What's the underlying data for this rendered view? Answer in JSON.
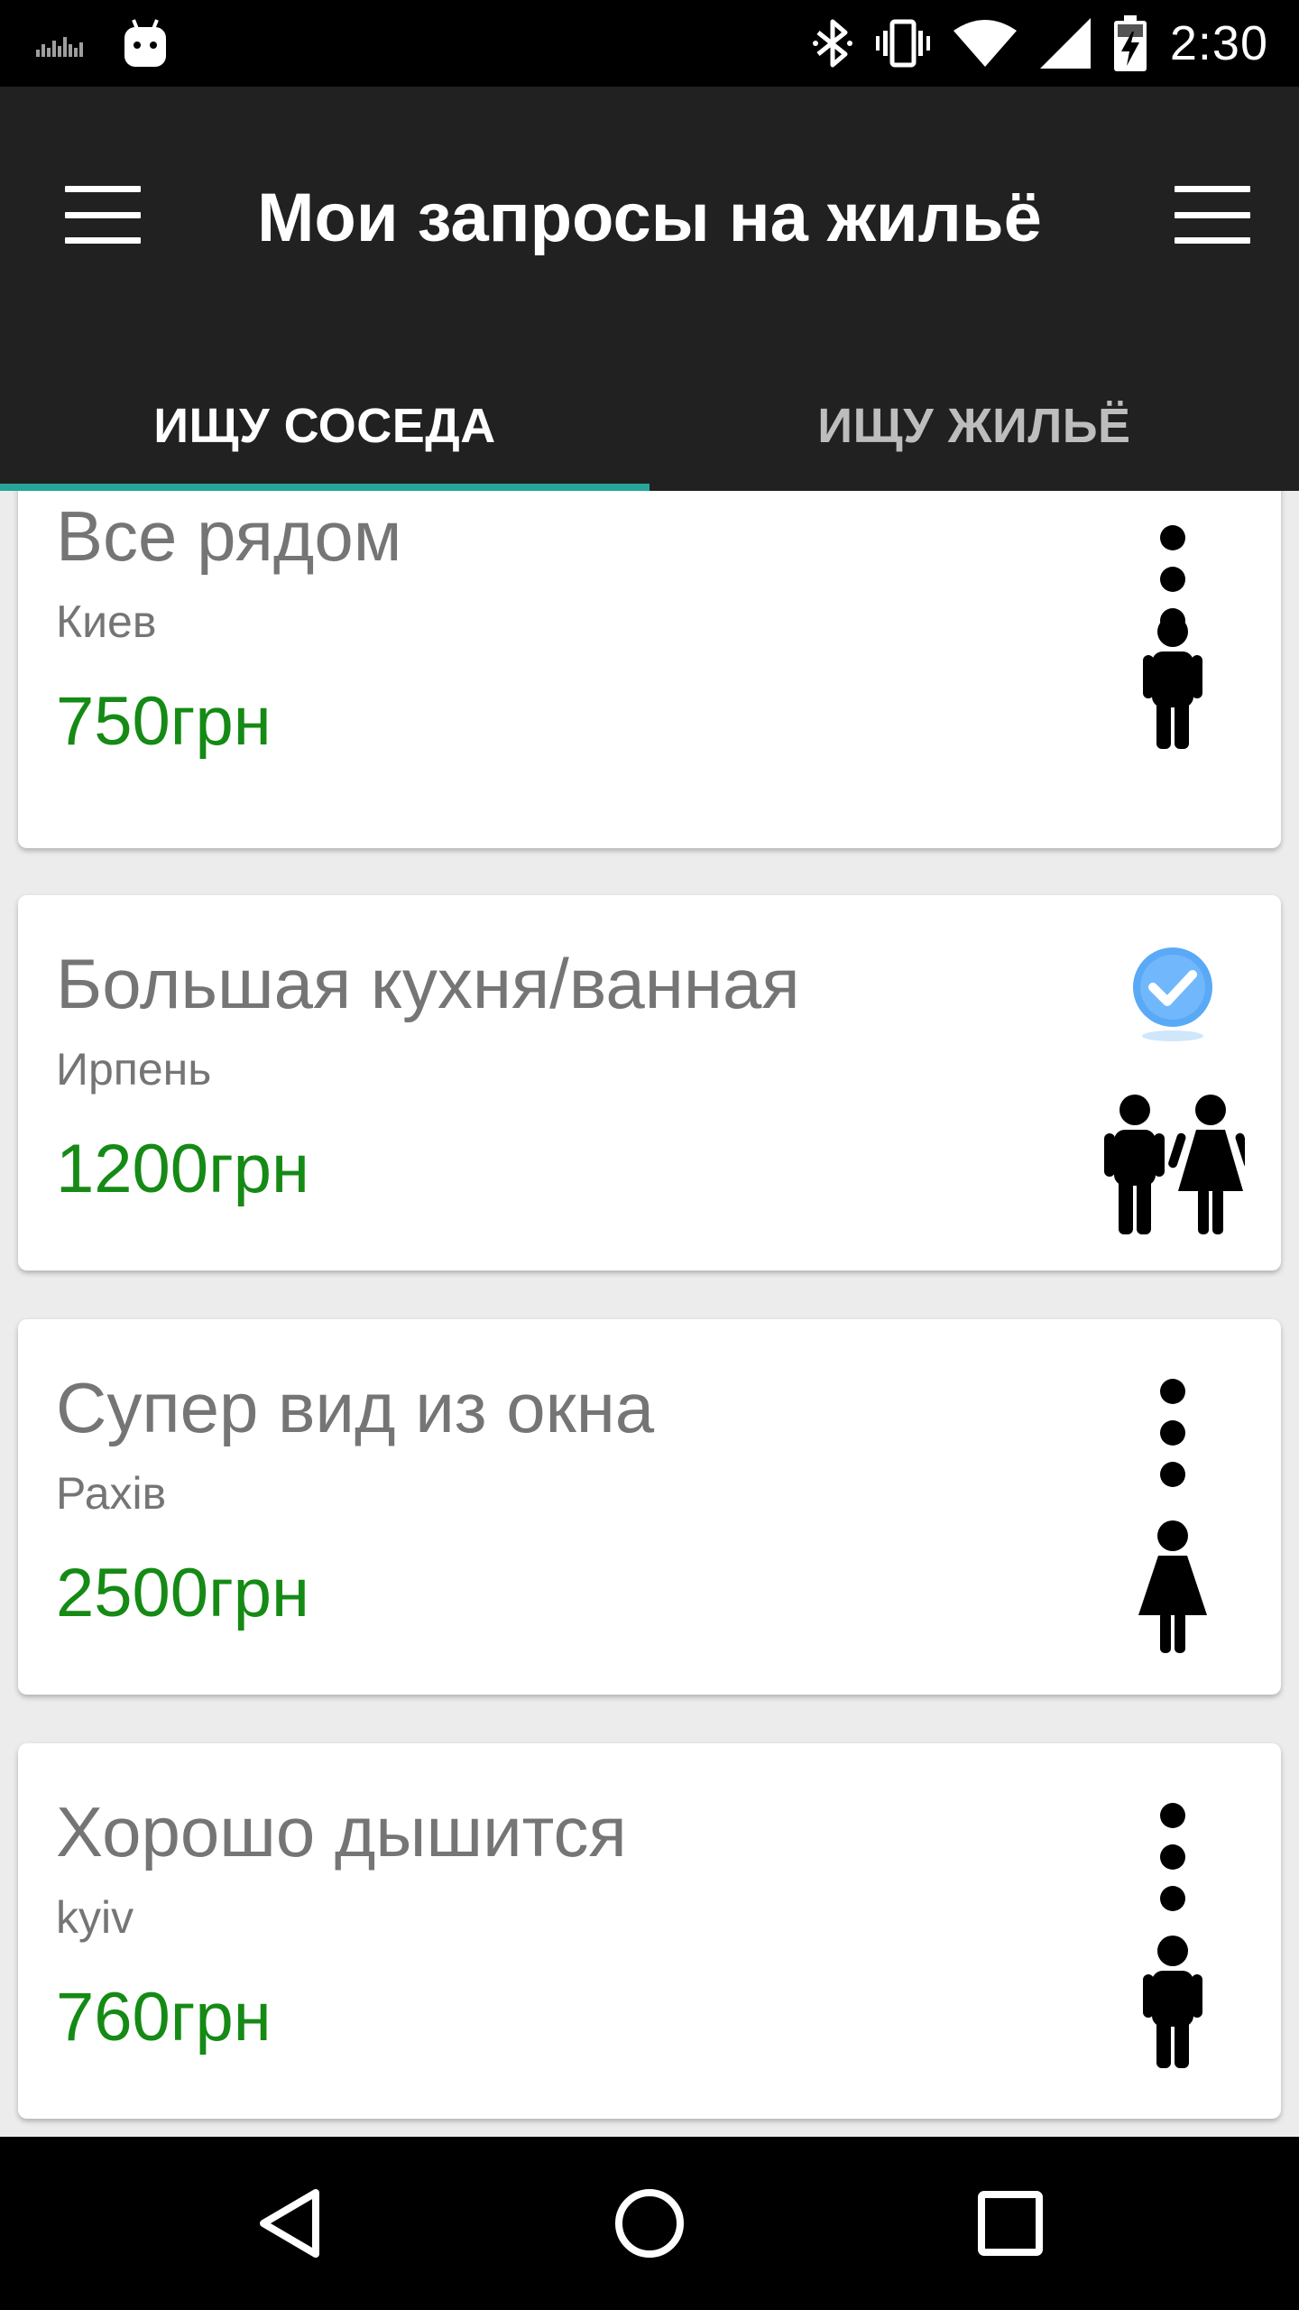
{
  "status_bar": {
    "time": "2:30",
    "icons": [
      "signal-strength-icon",
      "android-notification-icon",
      "bluetooth-icon",
      "vibrate-icon",
      "wifi-icon",
      "cell-signal-icon",
      "battery-charging-icon"
    ]
  },
  "app_bar": {
    "title": "Мои запросы на жильё",
    "left_icon": "menu-icon",
    "right_icon": "menu-icon"
  },
  "tabs": [
    {
      "label": "ИЩУ СОСЕДА",
      "active": true
    },
    {
      "label": "ИЩУ ЖИЛЬЁ",
      "active": false
    }
  ],
  "cards": [
    {
      "title": "Все рядом",
      "city": "Киев",
      "price": "750грн",
      "action_icon": "more-vert-icon",
      "gender_icon": "male-person-icon"
    },
    {
      "title": "Большая кухня/ванная",
      "city": "Ирпень",
      "price": "1200грн",
      "action_icon": "check-circle-icon",
      "gender_icon": "male-female-couple-icon"
    },
    {
      "title": "Супер вид из окна",
      "city": "Рахів",
      "price": "2500грн",
      "action_icon": "more-vert-icon",
      "gender_icon": "female-person-icon"
    },
    {
      "title": "Хорошо дышится",
      "city": "kyiv",
      "price": "760грн",
      "action_icon": "more-vert-icon",
      "gender_icon": "male-person-icon"
    }
  ],
  "colors": {
    "app_bar": "#212121",
    "tab_indicator": "#26a69a",
    "price": "#158a15",
    "text_secondary": "#757575",
    "check_blue": "#4a9ff5"
  },
  "nav_bar": {
    "icons": [
      "back-icon",
      "home-icon",
      "recents-icon"
    ]
  }
}
